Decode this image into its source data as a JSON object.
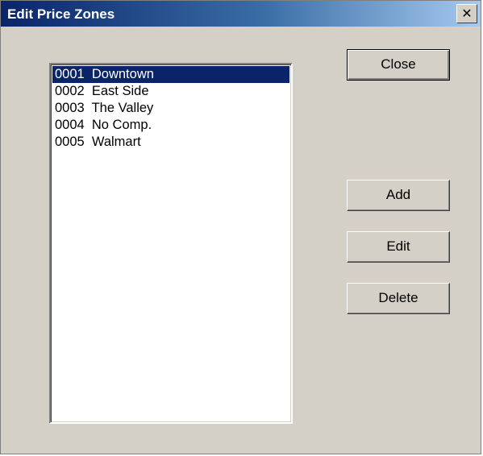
{
  "window": {
    "title": "Edit Price Zones",
    "close_glyph": "✕"
  },
  "zones": {
    "items": [
      {
        "label": "0001  Downtown",
        "selected": true
      },
      {
        "label": "0002  East Side",
        "selected": false
      },
      {
        "label": "0003  The Valley",
        "selected": false
      },
      {
        "label": "0004  No Comp.",
        "selected": false
      },
      {
        "label": "0005  Walmart",
        "selected": false
      }
    ]
  },
  "buttons": {
    "close": "Close",
    "add": "Add",
    "edit": "Edit",
    "delete": "Delete"
  },
  "colors": {
    "dialog_background": "#d4d0c8",
    "selection": "#0a246a",
    "title_gradient_start": "#0a246a",
    "title_gradient_end": "#a6caf0"
  }
}
